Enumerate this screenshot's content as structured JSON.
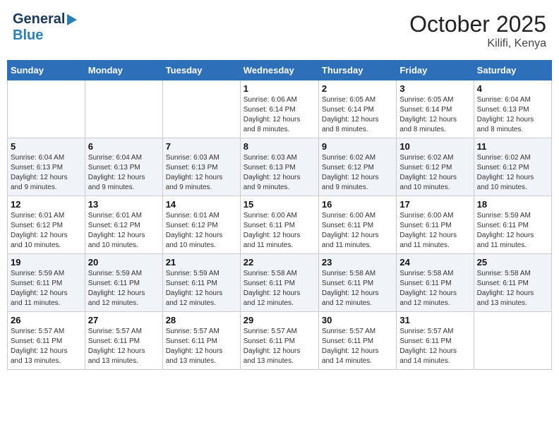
{
  "header": {
    "logo_general": "General",
    "logo_blue": "Blue",
    "month_title": "October 2025",
    "location": "Kilifi, Kenya"
  },
  "days_of_week": [
    "Sunday",
    "Monday",
    "Tuesday",
    "Wednesday",
    "Thursday",
    "Friday",
    "Saturday"
  ],
  "weeks": [
    [
      {
        "day": "",
        "info": ""
      },
      {
        "day": "",
        "info": ""
      },
      {
        "day": "",
        "info": ""
      },
      {
        "day": "1",
        "info": "Sunrise: 6:06 AM\nSunset: 6:14 PM\nDaylight: 12 hours\nand 8 minutes."
      },
      {
        "day": "2",
        "info": "Sunrise: 6:05 AM\nSunset: 6:14 PM\nDaylight: 12 hours\nand 8 minutes."
      },
      {
        "day": "3",
        "info": "Sunrise: 6:05 AM\nSunset: 6:14 PM\nDaylight: 12 hours\nand 8 minutes."
      },
      {
        "day": "4",
        "info": "Sunrise: 6:04 AM\nSunset: 6:13 PM\nDaylight: 12 hours\nand 8 minutes."
      }
    ],
    [
      {
        "day": "5",
        "info": "Sunrise: 6:04 AM\nSunset: 6:13 PM\nDaylight: 12 hours\nand 9 minutes."
      },
      {
        "day": "6",
        "info": "Sunrise: 6:04 AM\nSunset: 6:13 PM\nDaylight: 12 hours\nand 9 minutes."
      },
      {
        "day": "7",
        "info": "Sunrise: 6:03 AM\nSunset: 6:13 PM\nDaylight: 12 hours\nand 9 minutes."
      },
      {
        "day": "8",
        "info": "Sunrise: 6:03 AM\nSunset: 6:13 PM\nDaylight: 12 hours\nand 9 minutes."
      },
      {
        "day": "9",
        "info": "Sunrise: 6:02 AM\nSunset: 6:12 PM\nDaylight: 12 hours\nand 9 minutes."
      },
      {
        "day": "10",
        "info": "Sunrise: 6:02 AM\nSunset: 6:12 PM\nDaylight: 12 hours\nand 10 minutes."
      },
      {
        "day": "11",
        "info": "Sunrise: 6:02 AM\nSunset: 6:12 PM\nDaylight: 12 hours\nand 10 minutes."
      }
    ],
    [
      {
        "day": "12",
        "info": "Sunrise: 6:01 AM\nSunset: 6:12 PM\nDaylight: 12 hours\nand 10 minutes."
      },
      {
        "day": "13",
        "info": "Sunrise: 6:01 AM\nSunset: 6:12 PM\nDaylight: 12 hours\nand 10 minutes."
      },
      {
        "day": "14",
        "info": "Sunrise: 6:01 AM\nSunset: 6:12 PM\nDaylight: 12 hours\nand 10 minutes."
      },
      {
        "day": "15",
        "info": "Sunrise: 6:00 AM\nSunset: 6:11 PM\nDaylight: 12 hours\nand 11 minutes."
      },
      {
        "day": "16",
        "info": "Sunrise: 6:00 AM\nSunset: 6:11 PM\nDaylight: 12 hours\nand 11 minutes."
      },
      {
        "day": "17",
        "info": "Sunrise: 6:00 AM\nSunset: 6:11 PM\nDaylight: 12 hours\nand 11 minutes."
      },
      {
        "day": "18",
        "info": "Sunrise: 5:59 AM\nSunset: 6:11 PM\nDaylight: 12 hours\nand 11 minutes."
      }
    ],
    [
      {
        "day": "19",
        "info": "Sunrise: 5:59 AM\nSunset: 6:11 PM\nDaylight: 12 hours\nand 11 minutes."
      },
      {
        "day": "20",
        "info": "Sunrise: 5:59 AM\nSunset: 6:11 PM\nDaylight: 12 hours\nand 12 minutes."
      },
      {
        "day": "21",
        "info": "Sunrise: 5:59 AM\nSunset: 6:11 PM\nDaylight: 12 hours\nand 12 minutes."
      },
      {
        "day": "22",
        "info": "Sunrise: 5:58 AM\nSunset: 6:11 PM\nDaylight: 12 hours\nand 12 minutes."
      },
      {
        "day": "23",
        "info": "Sunrise: 5:58 AM\nSunset: 6:11 PM\nDaylight: 12 hours\nand 12 minutes."
      },
      {
        "day": "24",
        "info": "Sunrise: 5:58 AM\nSunset: 6:11 PM\nDaylight: 12 hours\nand 12 minutes."
      },
      {
        "day": "25",
        "info": "Sunrise: 5:58 AM\nSunset: 6:11 PM\nDaylight: 12 hours\nand 13 minutes."
      }
    ],
    [
      {
        "day": "26",
        "info": "Sunrise: 5:57 AM\nSunset: 6:11 PM\nDaylight: 12 hours\nand 13 minutes."
      },
      {
        "day": "27",
        "info": "Sunrise: 5:57 AM\nSunset: 6:11 PM\nDaylight: 12 hours\nand 13 minutes."
      },
      {
        "day": "28",
        "info": "Sunrise: 5:57 AM\nSunset: 6:11 PM\nDaylight: 12 hours\nand 13 minutes."
      },
      {
        "day": "29",
        "info": "Sunrise: 5:57 AM\nSunset: 6:11 PM\nDaylight: 12 hours\nand 13 minutes."
      },
      {
        "day": "30",
        "info": "Sunrise: 5:57 AM\nSunset: 6:11 PM\nDaylight: 12 hours\nand 14 minutes."
      },
      {
        "day": "31",
        "info": "Sunrise: 5:57 AM\nSunset: 6:11 PM\nDaylight: 12 hours\nand 14 minutes."
      },
      {
        "day": "",
        "info": ""
      }
    ]
  ]
}
